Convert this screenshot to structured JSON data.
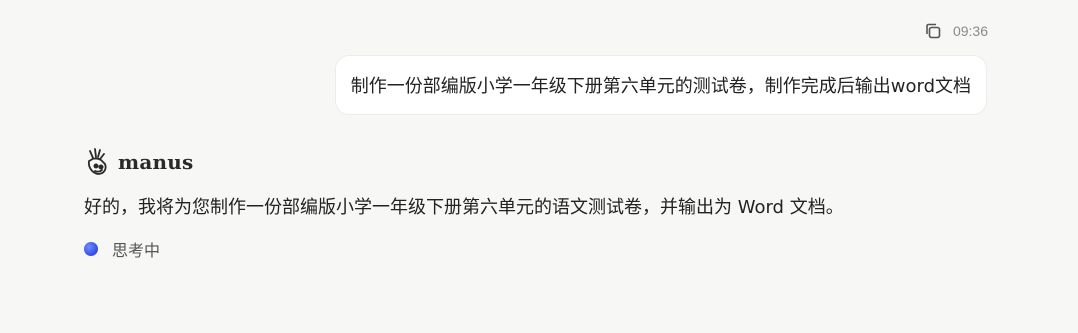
{
  "user_message": {
    "time": "09:36",
    "copy_icon": "copy-icon",
    "text": "制作一份部编版小学一年级下册第六单元的测试卷，制作完成后输出word文档"
  },
  "assistant": {
    "logo_icon": "manus-logo-icon",
    "brand": "manus",
    "reply": "好的，我将为您制作一份部编版小学一年级下册第六单元的语文测试卷，并输出为 Word 文档。",
    "status": "思考中",
    "status_color": "#3a55e6"
  }
}
